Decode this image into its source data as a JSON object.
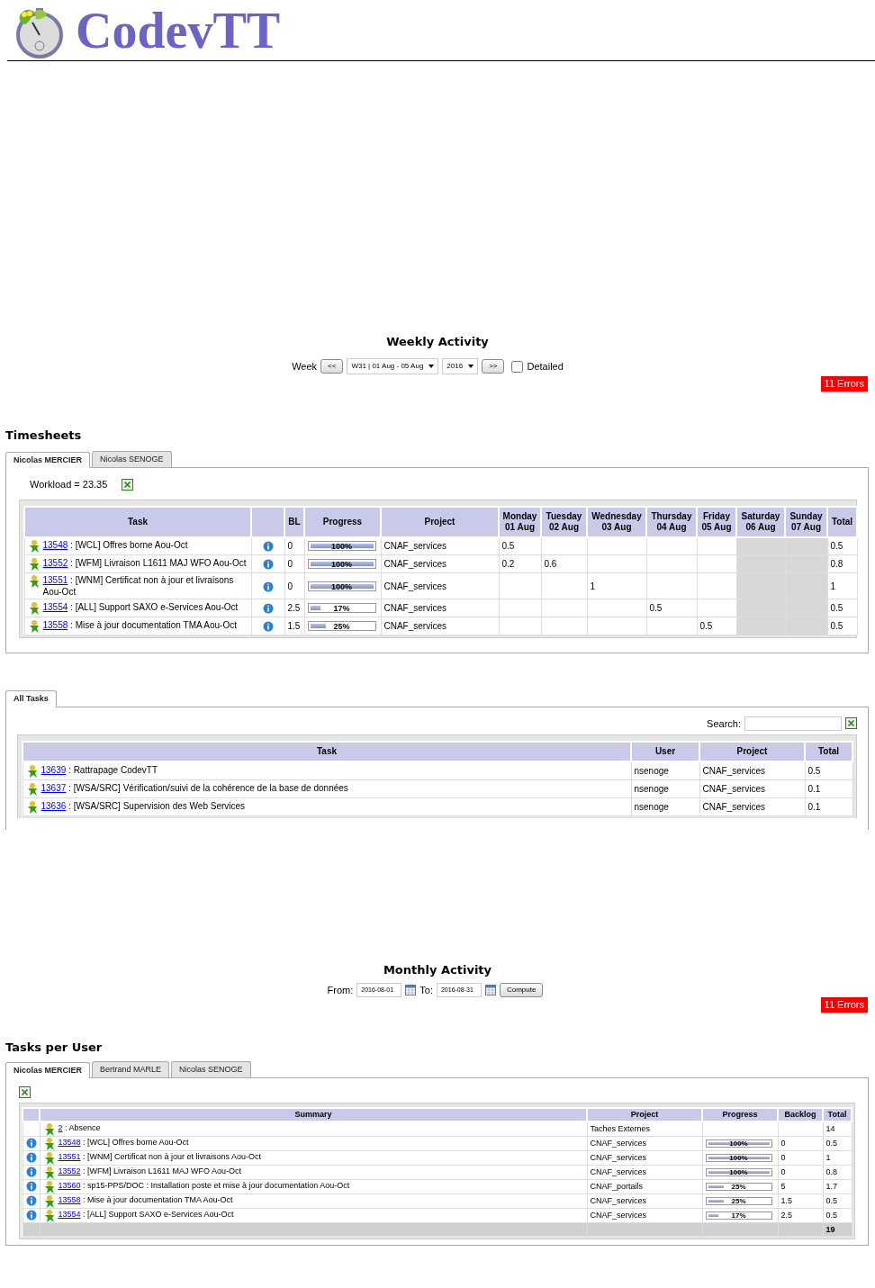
{
  "logo": {
    "text": "CodevTT"
  },
  "weekly": {
    "title": "Weekly Activity",
    "week_label": "Week",
    "prev": "<<",
    "week_select": "W31 | 01 Aug - 05 Aug",
    "year_select": "2016",
    "next": ">>",
    "detailed": {
      "label": "Detailed",
      "checked": false
    },
    "errors": "11 Errors"
  },
  "timesheets": {
    "title": "Timesheets",
    "tabs": [
      {
        "label": "Nicolas MERCIER",
        "selected": true
      },
      {
        "label": "Nicolas SENOGE",
        "selected": false
      }
    ],
    "workload": "Workload = 23.35",
    "columns": [
      {
        "kind": "task",
        "label": "Task"
      },
      {
        "kind": "info"
      },
      {
        "kind": "bl",
        "label": "BL"
      },
      {
        "kind": "progress",
        "label": "Progress"
      },
      {
        "kind": "project",
        "label": "Project"
      },
      {
        "kind": "day",
        "label": "Monday",
        "sub": "01 Aug",
        "weekend": false
      },
      {
        "kind": "day",
        "label": "Tuesday",
        "sub": "02 Aug",
        "weekend": false
      },
      {
        "kind": "day",
        "label": "Wednesday",
        "sub": "03 Aug",
        "weekend": false
      },
      {
        "kind": "day",
        "label": "Thursday",
        "sub": "04 Aug",
        "weekend": false
      },
      {
        "kind": "day",
        "label": "Friday",
        "sub": "05 Aug",
        "weekend": false
      },
      {
        "kind": "day",
        "label": "Saturday",
        "sub": "06 Aug",
        "weekend": true
      },
      {
        "kind": "day",
        "label": "Sunday",
        "sub": "07 Aug",
        "weekend": true
      },
      {
        "kind": "total",
        "label": "Total"
      }
    ],
    "rows": [
      {
        "id": "13548",
        "summary": ": [WCL] Offres borne Aou-Oct",
        "bl": "0",
        "progress": {
          "level": 1,
          "label": "100%"
        },
        "project": "CNAF_services",
        "monday": "0.5",
        "total": "0.5"
      },
      {
        "id": "13552",
        "summary": ": [WFM] Livraison L1611 MAJ WFO Aou-Oct",
        "bl": "0",
        "progress": {
          "level": 1,
          "label": "100%"
        },
        "project": "CNAF_services",
        "monday": "0.2",
        "tuesday": "0.6",
        "total": "0.8"
      },
      {
        "id": "13551",
        "summary": ": [WNM] Certificat non à jour et livraisons Aou-Oct",
        "bl": "0",
        "progress": {
          "level": 1,
          "label": "100%"
        },
        "project": "CNAF_services",
        "wednesday": "1",
        "total": "1"
      },
      {
        "id": "13554",
        "summary": ": [ALL] Support SAXO e-Services Aou-Oct",
        "bl": "2.5",
        "progress": {
          "level": 0.17,
          "label": "17%"
        },
        "project": "CNAF_services",
        "thursday": "0.5",
        "total": "0.5"
      },
      {
        "id": "13558",
        "summary": ": Mise à jour documentation TMA Aou-Oct",
        "bl": "1.5",
        "progress": {
          "level": 0.25,
          "label": "25%"
        },
        "project": "CNAF_services",
        "friday": "0.5",
        "total": "0.5"
      }
    ]
  },
  "all_tasks": {
    "tabs": [
      {
        "label": "All Tasks",
        "selected": true
      }
    ],
    "search_label": "Search:",
    "columns": [
      "Task",
      "User",
      "Project",
      "Total"
    ],
    "rows": [
      {
        "id": "13639",
        "summary": ": Rattrapage CodevTT",
        "user": "nsenoge",
        "project": "CNAF_services",
        "total": "0.5"
      },
      {
        "id": "13637",
        "summary": ": [WSA/SRC] Vérification/suivi de la cohérence de la base de données",
        "user": "nsenoge",
        "project": "CNAF_services",
        "total": "0.1"
      },
      {
        "id": "13636",
        "summary": ": [WSA/SRC] Supervision des Web Services",
        "user": "nsenoge",
        "project": "CNAF_services",
        "total": "0.1"
      }
    ]
  },
  "monthly": {
    "title": "Monthly Activity",
    "from_label": "From:",
    "from_value": "2016-08-01",
    "to_label": "To:",
    "to_value": "2016-08-31",
    "compute": "Compute",
    "errors": "11 Errors"
  },
  "tasks_per_user": {
    "title": "Tasks per User",
    "tabs": [
      {
        "label": "Nicolas MERCIER",
        "selected": true
      },
      {
        "label": "Bertrand MARLE",
        "selected": false
      },
      {
        "label": "Nicolas SENOGE",
        "selected": false
      }
    ],
    "columns": [
      "Summary",
      "Project",
      "Progress",
      "Backlog",
      "Total"
    ],
    "rows": [
      {
        "kind": "absence",
        "id": "2",
        "summary": ": Absence",
        "project": "Taches Externes",
        "total": "14"
      },
      {
        "kind": "task",
        "id": "13548",
        "summary": ": [WCL] Offres borne Aou-Oct",
        "project": "CNAF_services",
        "progress": {
          "level": 1,
          "label": "100%"
        },
        "backlog": "0",
        "total": "0.5"
      },
      {
        "kind": "task",
        "id": "13551",
        "summary": ": [WNM] Certificat non à jour et livraisons Aou-Oct",
        "project": "CNAF_services",
        "progress": {
          "level": 1,
          "label": "100%"
        },
        "backlog": "0",
        "total": "1"
      },
      {
        "kind": "task",
        "id": "13552",
        "summary": ": [WFM] Livraison L1611 MAJ WFO Aou-Oct",
        "project": "CNAF_services",
        "progress": {
          "level": 1,
          "label": "100%"
        },
        "backlog": "0",
        "total": "0.8"
      },
      {
        "kind": "task",
        "id": "13560",
        "summary": ": sp15-PPS/DOC : Installation poste et mise à jour documentation Aou-Oct",
        "project": "CNAF_portails",
        "progress": {
          "level": 0.25,
          "label": "25%"
        },
        "backlog": "5",
        "total": "1.7"
      },
      {
        "kind": "task",
        "id": "13558",
        "summary": ": Mise à jour documentation TMA Aou-Oct",
        "project": "CNAF_services",
        "progress": {
          "level": 0.25,
          "label": "25%"
        },
        "backlog": "1.5",
        "total": "0.5"
      },
      {
        "kind": "task",
        "id": "13554",
        "summary": ": [ALL] Support SAXO e-Services Aou-Oct",
        "project": "CNAF_services",
        "progress": {
          "level": 0.17,
          "label": "17%"
        },
        "backlog": "2.5",
        "total": "0.5"
      }
    ],
    "grand_total": "19"
  }
}
